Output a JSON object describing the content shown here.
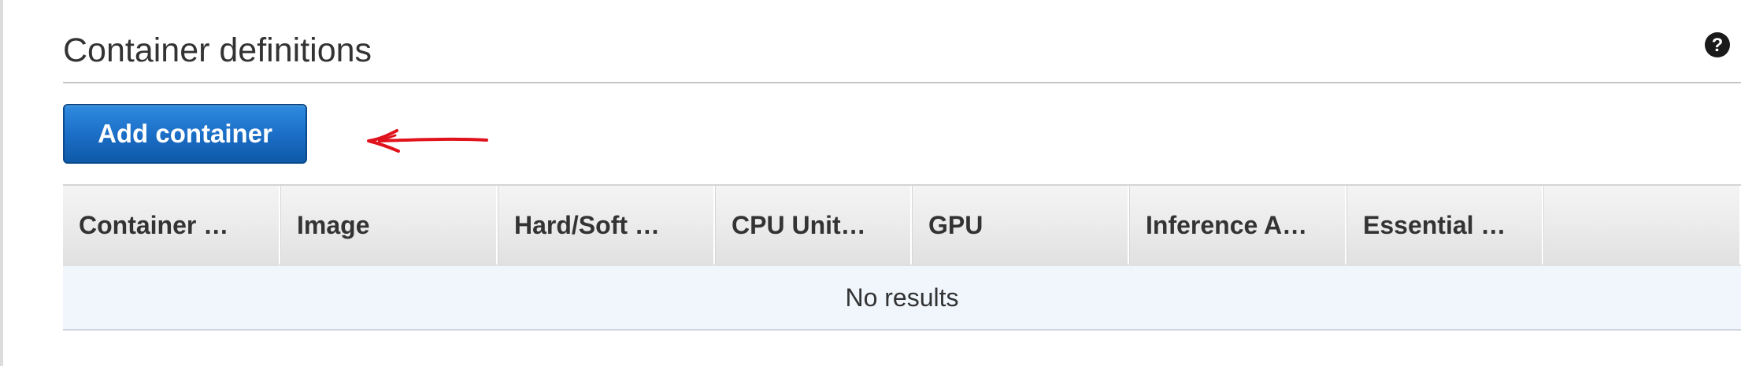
{
  "section": {
    "title": "Container definitions",
    "help_icon": "question-circle-icon"
  },
  "toolbar": {
    "add_label": "Add container"
  },
  "annotation": {
    "arrow_icon": "red-hand-drawn-arrow",
    "color": "#e0121c"
  },
  "table": {
    "columns": [
      "Container …",
      "Image",
      "Hard/Soft …",
      "CPU Unit…",
      "GPU",
      "Inference A…",
      "Essential …",
      ""
    ],
    "empty_message": "No results"
  },
  "colors": {
    "primary_button": "#1a6cc4",
    "table_header": "#e9e9e9",
    "empty_row": "#f0f6fc"
  }
}
